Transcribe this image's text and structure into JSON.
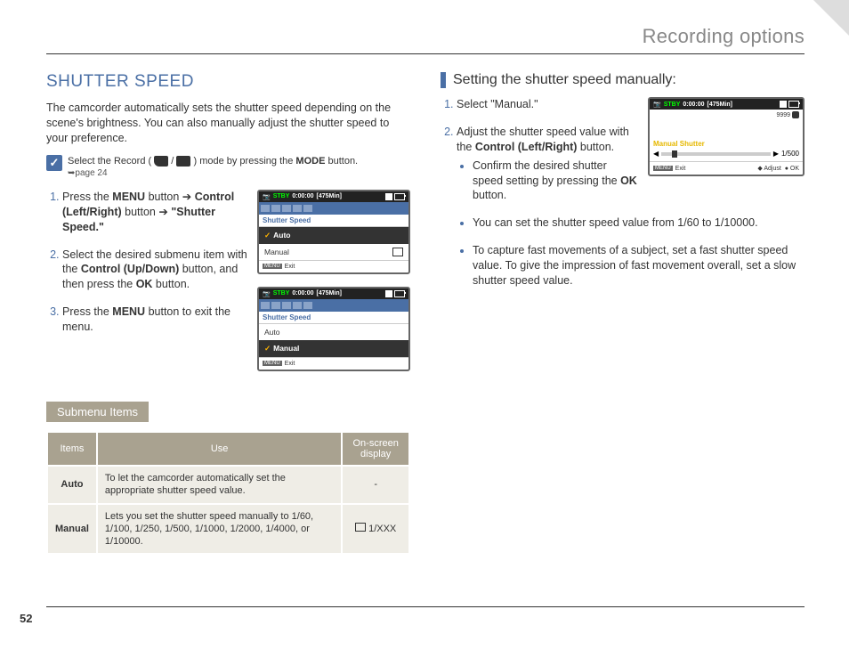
{
  "page_title": "Recording options",
  "page_number": "52",
  "left": {
    "heading": "SHUTTER SPEED",
    "intro": "The camcorder automatically sets the shutter speed depending on the scene's brightness. You can also manually adjust the shutter speed to your preference.",
    "note_prefix": "Select the Record (",
    "note_mid": " / ",
    "note_suffix_a": " ) mode by pressing the ",
    "note_mode": "MODE",
    "note_suffix_b": " button.",
    "note_sub": "➥page 24",
    "steps": [
      {
        "pre": "Press the ",
        "b1": "MENU",
        "mid1": " button ➔ ",
        "b2": "Control (Left/Right)",
        "mid2": " button ➔ ",
        "b3": "\"Shutter Speed.\""
      },
      {
        "pre": "Select the desired submenu item with the ",
        "b1": "Control (Up/Down)",
        "mid1": " button, and then press the ",
        "b2": "OK",
        "mid2": " button.",
        "b3": ""
      },
      {
        "pre": "Press the ",
        "b1": "MENU",
        "mid1": " button to exit the menu.",
        "b2": "",
        "mid2": "",
        "b3": ""
      }
    ],
    "screen1": {
      "stby": "STBY",
      "time": "0:00:00",
      "remain": "[475Min]",
      "title": "Shutter Speed",
      "row_a": "Auto",
      "row_b": "Manual",
      "menu": "MENU",
      "exit": "Exit"
    },
    "screen2": {
      "stby": "STBY",
      "time": "0:00:00",
      "remain": "[475Min]",
      "title": "Shutter Speed",
      "row_a": "Auto",
      "row_b": "Manual",
      "menu": "MENU",
      "exit": "Exit"
    },
    "submenu_label": "Submenu Items",
    "table": {
      "headers": [
        "Items",
        "Use",
        "On-screen display"
      ],
      "rows": [
        {
          "item": "Auto",
          "use": "To let the camcorder automatically set the appropriate shutter speed value.",
          "disp": "-"
        },
        {
          "item": "Manual",
          "use": "Lets you set the shutter speed manually to 1/60, 1/100, 1/250, 1/500, 1/1000, 1/2000, 1/4000, or 1/10000.",
          "disp": " 1/XXX"
        }
      ]
    }
  },
  "right": {
    "heading": "Setting the shutter speed manually:",
    "step1": "Select \"Manual.\"",
    "step2_pre": "Adjust the shutter speed value with the ",
    "step2_b": "Control (Left/Right)",
    "step2_post": " button.",
    "sub1_pre": "Confirm the desired shutter speed setting by pressing the ",
    "sub1_b": "OK",
    "sub1_post": " button.",
    "sub2": "You can set the shutter speed value from 1/60 to 1/10000.",
    "sub3": "To capture fast movements of a subject, set a fast shutter speed value. To give the impression of fast movement overall, set a slow shutter speed value.",
    "screen": {
      "stby": "STBY",
      "time": "0:00:00",
      "remain": "[475Min]",
      "res": "9999",
      "label": "Manual Shutter",
      "value": "1/500",
      "menu": "MENU",
      "exit": "Exit",
      "adjust": "Adjust",
      "ok": "OK"
    }
  }
}
